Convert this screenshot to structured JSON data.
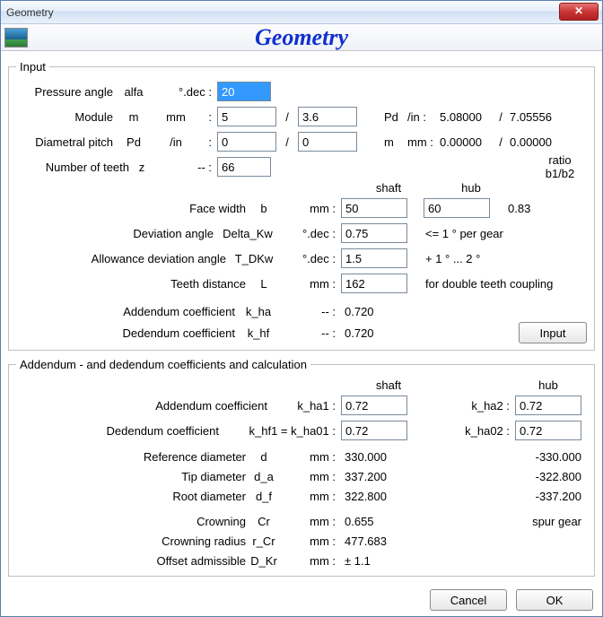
{
  "window": {
    "title": "Geometry"
  },
  "header": {
    "title": "Geometry"
  },
  "input": {
    "legend": "Input",
    "pressure_angle": {
      "label": "Pressure angle",
      "sym": "alfa",
      "unit": "°.dec :",
      "value": "20"
    },
    "module": {
      "label": "Module",
      "sym": "m",
      "unit": "mm",
      "colon": ":",
      "v1": "5",
      "sep": "/",
      "v2": "3.6",
      "pd_label": "Pd",
      "pd_unit": "/in :",
      "pd1": "5.08000",
      "pd_sep": "/",
      "pd2": "7.05556"
    },
    "diametral": {
      "label": "Diametral pitch",
      "sym": "Pd",
      "unit": "/in",
      "colon": ":",
      "v1": "0",
      "sep": "/",
      "v2": "0",
      "m_label": "m",
      "m_unit": "mm :",
      "m1": "0.00000",
      "m_sep": "/",
      "m2": "0.00000"
    },
    "teeth": {
      "label": "Number of teeth",
      "sym": "z",
      "unit": "--  :",
      "value": "66"
    },
    "col_shaft": "shaft",
    "col_hub": "hub",
    "ratio_label1": "ratio",
    "ratio_label2": "b1/b2",
    "facewidth": {
      "label": "Face width",
      "sym": "b",
      "unit": "mm :",
      "shaft": "50",
      "hub": "60",
      "ratio": "0.83"
    },
    "deviation": {
      "label": "Deviation angle",
      "sym": "Delta_Kw",
      "unit": "°.dec :",
      "value": "0.75",
      "note": "<=  1 ° per gear"
    },
    "allowdev": {
      "label": "Allowance deviation angle",
      "sym": "T_DKw",
      "unit": "°.dec :",
      "value": "1.5",
      "note": "+ 1 °  ...  2 °"
    },
    "teethdist": {
      "label": "Teeth distance",
      "sym": "L",
      "unit": "mm :",
      "value": "162",
      "note": "for double teeth coupling"
    },
    "add_coef": {
      "label": "Addendum coefficient",
      "sym": "k_ha",
      "unit": "--  :",
      "value": "0.720"
    },
    "ded_coef": {
      "label": "Dedendum coefficient",
      "sym": "k_hf",
      "unit": "--  :",
      "value": "0.720"
    },
    "input_button": "Input"
  },
  "calc": {
    "legend": "Addendum - and dedendum coefficients and  calculation",
    "col_shaft": "shaft",
    "col_hub": "hub",
    "add": {
      "label": "Addendum coefficient",
      "sym1": "k_ha1 :",
      "v1": "0.72",
      "sym2": "k_ha2 :",
      "v2": "0.72"
    },
    "ded": {
      "label": "Dedendum coefficient",
      "sym1": "k_hf1 = k_ha01 :",
      "v1": "0.72",
      "sym2": "k_ha02 :",
      "v2": "0.72"
    },
    "refd": {
      "label": "Reference diameter",
      "sym": "d",
      "unit": "mm :",
      "v1": "330.000",
      "v2": "-330.000"
    },
    "tipd": {
      "label": "Tip diameter",
      "sym": "d_a",
      "unit": "mm :",
      "v1": "337.200",
      "v2": "-322.800"
    },
    "rootd": {
      "label": "Root diameter",
      "sym": "d_f",
      "unit": "mm :",
      "v1": "322.800",
      "v2": "-337.200"
    },
    "crowning": {
      "label": "Crowning",
      "sym": "Cr",
      "unit": "mm :",
      "v1": "0.655",
      "note": "spur gear"
    },
    "crownrad": {
      "label": "Crowning radius",
      "sym": "r_Cr",
      "unit": "mm :",
      "v1": "477.683"
    },
    "offset": {
      "label": "Offset admissible",
      "sym": "D_Kr",
      "unit": "mm :",
      "v1": "± 1.1"
    }
  },
  "footer": {
    "cancel": "Cancel",
    "ok": "OK"
  }
}
